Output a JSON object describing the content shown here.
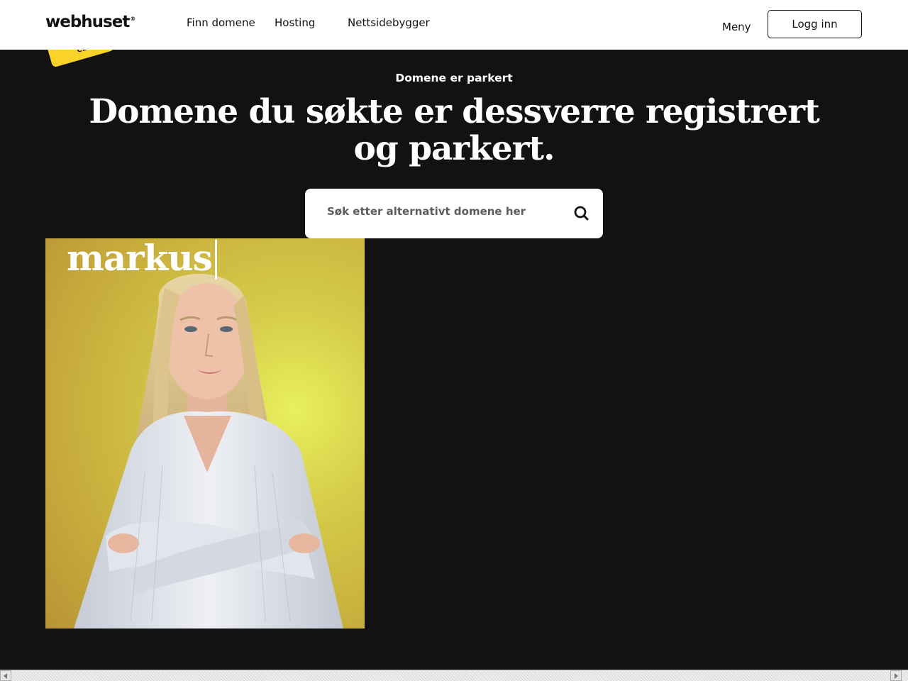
{
  "header": {
    "logo": "webhuset",
    "logo_mark": "®",
    "nav": [
      "Finn domene",
      "Hosting",
      "Nettsidebygger"
    ],
    "menu_label": "Meny",
    "login_label": "Logg inn"
  },
  "sticker": {
    "text": "CLIENT"
  },
  "hero": {
    "eyebrow": "Domene er parkert",
    "headline": "Domene du søkte er dessverre registrert og parkert."
  },
  "search": {
    "placeholder": "Søk etter alternativt domene her",
    "icon": "search-icon"
  },
  "photo": {
    "typed_text": "markus",
    "background_color": "#d6cc4a"
  },
  "colors": {
    "background": "#131213",
    "header": "#ffffff",
    "accent": "#f9d32a",
    "text_light": "#ffffff",
    "text_dark": "#131213"
  }
}
